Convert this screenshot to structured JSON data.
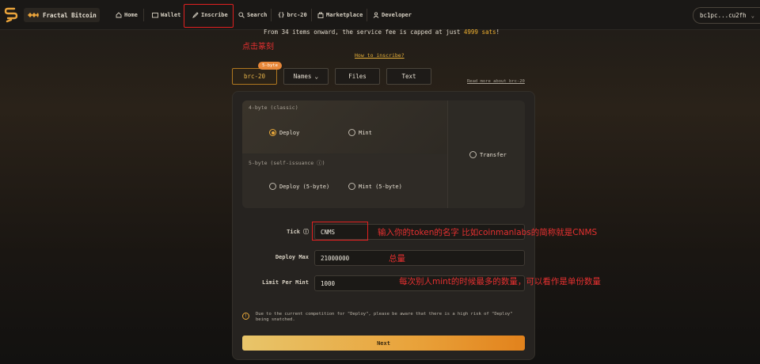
{
  "header": {
    "brand": "Fractal Bitcoin",
    "nav": [
      {
        "key": "home",
        "label": "Home"
      },
      {
        "key": "wallet",
        "label": "Wallet"
      },
      {
        "key": "inscribe",
        "label": "Inscribe"
      },
      {
        "key": "search",
        "label": "Search"
      },
      {
        "key": "brc20",
        "label": "brc-20"
      },
      {
        "key": "marketplace",
        "label": "Marketplace"
      },
      {
        "key": "developer",
        "label": "Developer"
      }
    ],
    "wallet_address": "bc1pc...cu2fh"
  },
  "notice": {
    "fee_prefix": "From 34 items onward, the service fee is capped at just ",
    "fee_highlight": "4999 sats",
    "fee_suffix": "!"
  },
  "annotations": {
    "click_inscribe": "点击篆刻",
    "tick_hint": "输入你的token的名字 比如coinmanlabs的简称就是CNMS",
    "total_hint": "总量",
    "limit_hint": "每次别人mint的时候最多的数量，可以看作是单份数量"
  },
  "how_to": "How to inscribe?",
  "types": {
    "badge": "5-byte",
    "brc20": "brc-20",
    "names": "Names",
    "files": "Files",
    "text": "Text"
  },
  "read_more": "Read more about brc-20",
  "options": {
    "classic_title": "4-byte (classic)",
    "deploy": "Deploy",
    "mint": "Mint",
    "self_title": "5-byte (self-issuance ⓘ)",
    "deploy5": "Deploy (5-byte)",
    "mint5": "Mint (5-byte)",
    "transfer": "Transfer",
    "selected": "Deploy"
  },
  "form": {
    "tick_label": "Tick",
    "tick_value": "CNMS",
    "max_label": "Deploy Max",
    "max_value": "21000000",
    "limit_label": "Limit Per Mint",
    "limit_value": "1000"
  },
  "warning": "Due to the current competition for \"Deploy\", please be aware that there is a high risk of \"Deploy\" being snatched.",
  "next_label": "Next"
}
